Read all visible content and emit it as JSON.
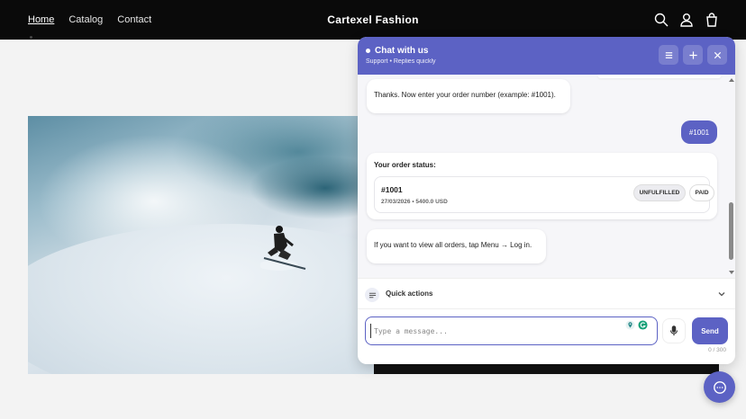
{
  "store": {
    "brand": "Cartexel Fashion",
    "nav": [
      {
        "label": "Home",
        "active": true
      },
      {
        "label": "Catalog",
        "active": false
      },
      {
        "label": "Contact",
        "active": false
      }
    ],
    "icons": [
      "search-icon",
      "account-icon",
      "cart-icon"
    ]
  },
  "chat": {
    "title": "Chat with us",
    "subtitle": "Support • Replies quickly",
    "accent": "#5c62c4",
    "header_buttons": [
      "menu-icon",
      "plus-icon",
      "close-icon"
    ],
    "messages": {
      "bot_prompt": "Thanks. Now enter your order number (example: #1001).",
      "user_reply": "#1001",
      "status_label": "Your order status:",
      "order": {
        "number": "#1001",
        "meta": "27/03/2026 • 5400.0 USD",
        "fulfillment": "UNFULFILLED",
        "payment": "PAID"
      },
      "hint": "If you want to view all orders, tap Menu → Log in."
    },
    "quick_actions": "Quick actions",
    "input": {
      "placeholder": "Type a message...",
      "value": ""
    },
    "send_label": "Send",
    "counter": "0 / 300"
  }
}
